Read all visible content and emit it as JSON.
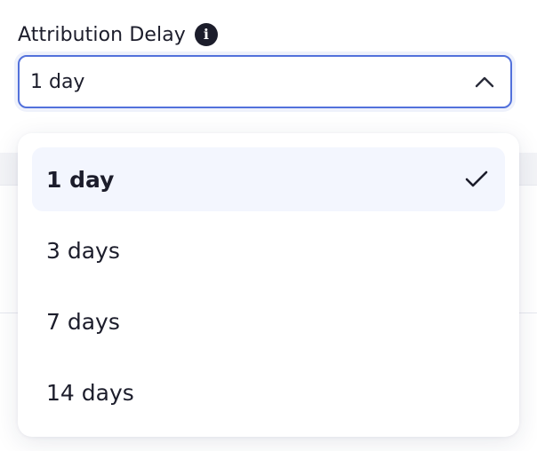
{
  "field": {
    "label": "Attribution Delay",
    "info_icon": "info-icon",
    "info_glyph": "i",
    "selected_value": "1 day",
    "toggle_icon": "chevron-up-icon",
    "focus_color": "#5271db"
  },
  "dropdown": {
    "options": [
      {
        "label": "1 day",
        "selected": true
      },
      {
        "label": "3 days",
        "selected": false
      },
      {
        "label": "7 days",
        "selected": false
      },
      {
        "label": "14 days",
        "selected": false
      }
    ],
    "selected_icon": "checkmark-icon",
    "selected_bg": "#f3f6fe"
  }
}
